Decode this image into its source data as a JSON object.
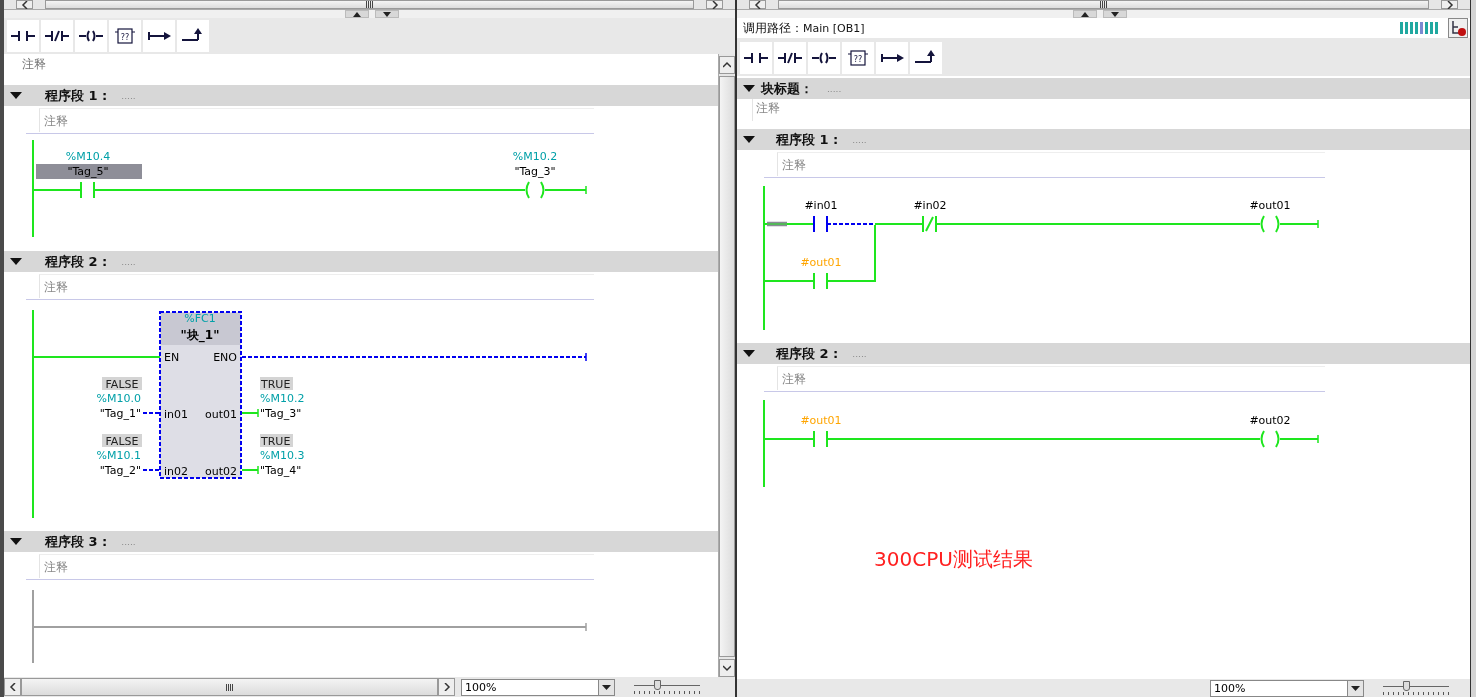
{
  "left_pane": {
    "toolbar": [
      {
        "kind": "no_contact"
      },
      {
        "kind": "nc_contact"
      },
      {
        "kind": "coil"
      },
      {
        "kind": "empty_box",
        "label": "??"
      },
      {
        "kind": "open_branch"
      },
      {
        "kind": "close_branch"
      }
    ],
    "block_comment": "注释",
    "networks": [
      {
        "kind": "contact_coil",
        "title": "程序段 1 :",
        "title_field": ".....",
        "expanded": true,
        "comment": "注释",
        "energized": true,
        "contact": {
          "address": "%M10.4",
          "tag": "\"Tag_5\"",
          "selected": true,
          "energized": true
        },
        "coil": {
          "address": "%M10.2",
          "tag": "\"Tag_3\"",
          "selected": false,
          "energized": true
        }
      },
      {
        "kind": "fc_call",
        "title": "程序段 2 :",
        "title_field": ".....",
        "expanded": true,
        "comment": "注释",
        "energized": true,
        "block": {
          "number": "%FC1",
          "name": "\"块_1\"",
          "en": "EN",
          "eno": "ENO",
          "eno_energized": false,
          "inputs": [
            {
              "pin": "in01",
              "value": "FALSE",
              "address": "%M10.0",
              "tag": "\"Tag_1\"",
              "energized": false
            },
            {
              "pin": "in02",
              "value": "FALSE",
              "address": "%M10.1",
              "tag": "\"Tag_2\"",
              "energized": false
            }
          ],
          "outputs": [
            {
              "pin": "out01",
              "value": "TRUE",
              "address": "%M10.2",
              "tag": "\"Tag_3\"",
              "energized": true
            },
            {
              "pin": "out02",
              "value": "TRUE",
              "address": "%M10.3",
              "tag": "\"Tag_4\"",
              "energized": true
            }
          ]
        }
      },
      {
        "kind": "empty",
        "title": "程序段 3 :",
        "title_field": ".....",
        "expanded": true,
        "comment": "注释",
        "energized": false
      }
    ],
    "zoom": "100%",
    "zoom_slider": {
      "level": 0.35
    }
  },
  "right_pane": {
    "call_path_label": "调用路径：",
    "call_path": "Main [OB1]",
    "toolbar": [
      {
        "kind": "no_contact"
      },
      {
        "kind": "nc_contact"
      },
      {
        "kind": "coil"
      },
      {
        "kind": "empty_box",
        "label": "??"
      },
      {
        "kind": "open_branch"
      },
      {
        "kind": "close_branch"
      }
    ],
    "block_title": {
      "title": "块标题：",
      "title_field": ".....",
      "expanded": true,
      "comment": "注释"
    },
    "networks": [
      {
        "kind": "latch_rung",
        "title": "程序段 1 :",
        "title_field": ".....",
        "expanded": true,
        "comment": "注释",
        "energized": true,
        "contact": {
          "operand": "#in01",
          "color": "#000000",
          "energized": false
        },
        "nc_contact": {
          "operand": "#in02",
          "color": "#000000",
          "energized": true
        },
        "coil": {
          "operand": "#out01",
          "color": "#000000",
          "energized": true
        },
        "branch_contact": {
          "operand": "#out01",
          "color": "#ffa500",
          "energized": true
        }
      },
      {
        "kind": "contact_coil",
        "title": "程序段 2 :",
        "title_field": ".....",
        "expanded": true,
        "comment": "注释",
        "energized": true,
        "contact": {
          "operand": "#out01",
          "color": "#ffa500",
          "energized": true
        },
        "coil": {
          "operand": "#out02",
          "color": "#000000",
          "energized": true
        }
      }
    ],
    "annotation": "300CPU测试结果",
    "zoom": "100%",
    "zoom_slider": {
      "level": 0.35
    }
  }
}
